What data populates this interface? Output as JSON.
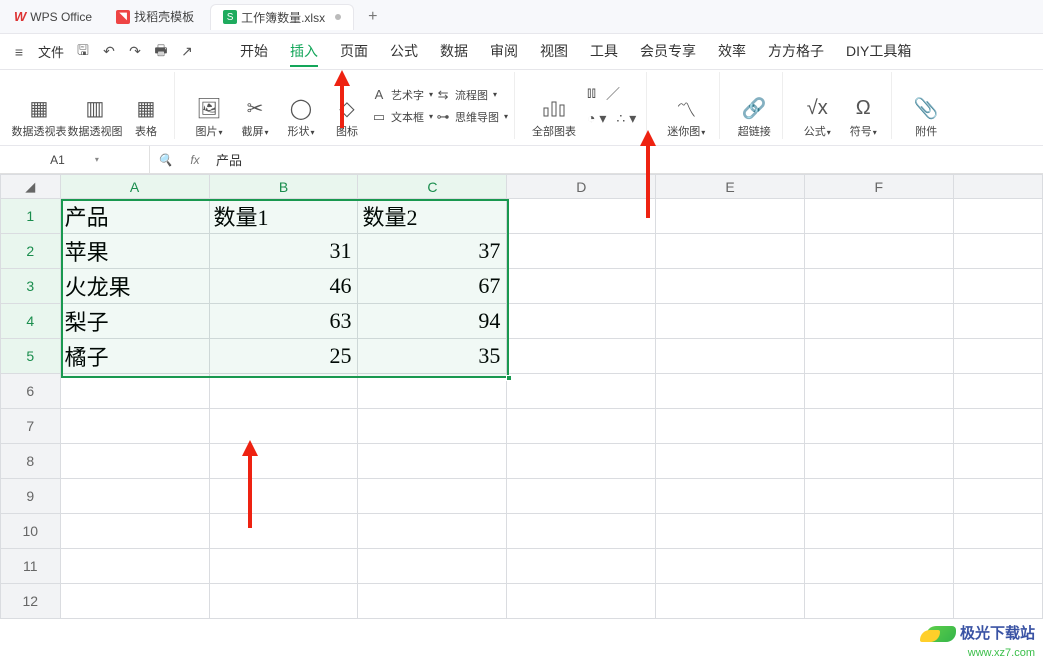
{
  "titlebar": {
    "app_name": "WPS Office",
    "tab_template": "找稻壳模板",
    "tab_file": "工作簿数量.xlsx",
    "add": "+"
  },
  "menu": {
    "more_icon": "≡",
    "file_label": "文件",
    "items": [
      "开始",
      "插入",
      "页面",
      "公式",
      "数据",
      "审阅",
      "视图",
      "工具",
      "会员专享",
      "效率",
      "方方格子",
      "DIY工具箱"
    ],
    "active_index": 1
  },
  "ribbon": {
    "pivot_table": "数据透视表",
    "pivot_chart": "数据透视图",
    "table": "表格",
    "picture": "图片",
    "screenshot": "截屏",
    "shapes": "形状",
    "icon": "图标",
    "wordart": "艺术字",
    "textbox": "文本框",
    "flowchart": "流程图",
    "mindmap": "思维导图",
    "all_charts": "全部图表",
    "sparkline": "迷你图",
    "hyperlink": "超链接",
    "formula": "公式",
    "symbol": "符号",
    "attach": "附件"
  },
  "fxbar": {
    "namebox": "A1",
    "fx_label": "fx",
    "value": "产品"
  },
  "columns": [
    "A",
    "B",
    "C",
    "D",
    "E",
    "F"
  ],
  "rows": [
    "1",
    "2",
    "3",
    "4",
    "5",
    "6",
    "7",
    "8",
    "9",
    "10",
    "11",
    "12"
  ],
  "chart_data": {
    "type": "table",
    "headers": [
      "产品",
      "数量1",
      "数量2"
    ],
    "records": [
      {
        "p": "苹果",
        "q1": 31,
        "q2": 37
      },
      {
        "p": "火龙果",
        "q1": 46,
        "q2": 67
      },
      {
        "p": "梨子",
        "q1": 63,
        "q2": 94
      },
      {
        "p": "橘子",
        "q1": 25,
        "q2": 35
      }
    ]
  },
  "watermark": {
    "line1": "极光下载站",
    "line2": "www.xz7.com"
  }
}
